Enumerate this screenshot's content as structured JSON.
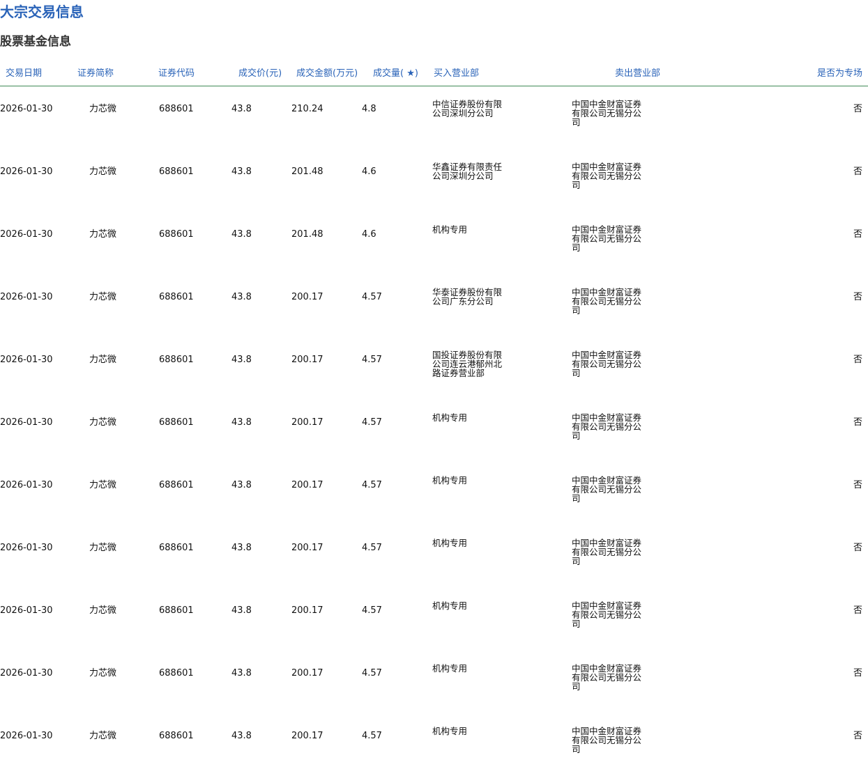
{
  "page_title": "大宗交易信息",
  "section_title": "股票基金信息",
  "table": {
    "headers": [
      "交易日期",
      "证券简称",
      "证券代码",
      "成交价(元)",
      "成交金额(万元)",
      "成交量( ★)",
      "买入营业部",
      "卖出营业部",
      "是否为专场"
    ],
    "rows": [
      [
        "2026-01-30",
        "力芯微",
        "688601",
        "43.8",
        "210.24",
        "4.8",
        "中信证券股份有限公司深圳分公司",
        "中国中金财富证券有限公司无锡分公司",
        "否"
      ],
      [
        "2026-01-30",
        "力芯微",
        "688601",
        "43.8",
        "201.48",
        "4.6",
        "华鑫证券有限责任公司深圳分公司",
        "中国中金财富证券有限公司无锡分公司",
        "否"
      ],
      [
        "2026-01-30",
        "力芯微",
        "688601",
        "43.8",
        "201.48",
        "4.6",
        "机构专用",
        "中国中金财富证券有限公司无锡分公司",
        "否"
      ],
      [
        "2026-01-30",
        "力芯微",
        "688601",
        "43.8",
        "200.17",
        "4.57",
        "华泰证券股份有限公司广东分公司",
        "中国中金财富证券有限公司无锡分公司",
        "否"
      ],
      [
        "2026-01-30",
        "力芯微",
        "688601",
        "43.8",
        "200.17",
        "4.57",
        "国投证券股份有限公司连云港郁州北路证券营业部",
        "中国中金财富证券有限公司无锡分公司",
        "否"
      ],
      [
        "2026-01-30",
        "力芯微",
        "688601",
        "43.8",
        "200.17",
        "4.57",
        "机构专用",
        "中国中金财富证券有限公司无锡分公司",
        "否"
      ],
      [
        "2026-01-30",
        "力芯微",
        "688601",
        "43.8",
        "200.17",
        "4.57",
        "机构专用",
        "中国中金财富证券有限公司无锡分公司",
        "否"
      ],
      [
        "2026-01-30",
        "力芯微",
        "688601",
        "43.8",
        "200.17",
        "4.57",
        "机构专用",
        "中国中金财富证券有限公司无锡分公司",
        "否"
      ],
      [
        "2026-01-30",
        "力芯微",
        "688601",
        "43.8",
        "200.17",
        "4.57",
        "机构专用",
        "中国中金财富证券有限公司无锡分公司",
        "否"
      ],
      [
        "2026-01-30",
        "力芯微",
        "688601",
        "43.8",
        "200.17",
        "4.57",
        "机构专用",
        "中国中金财富证券有限公司无锡分公司",
        "否"
      ],
      [
        "2026-01-30",
        "力芯微",
        "688601",
        "43.8",
        "200.17",
        "4.57",
        "机构专用",
        "中国中金财富证券有限公司无锡分公司",
        "否"
      ]
    ]
  },
  "colors": {
    "title": "#2a63b8",
    "header_text": "#2a63b8",
    "header_rule": "#3f8a55",
    "body_text": "#111111"
  }
}
